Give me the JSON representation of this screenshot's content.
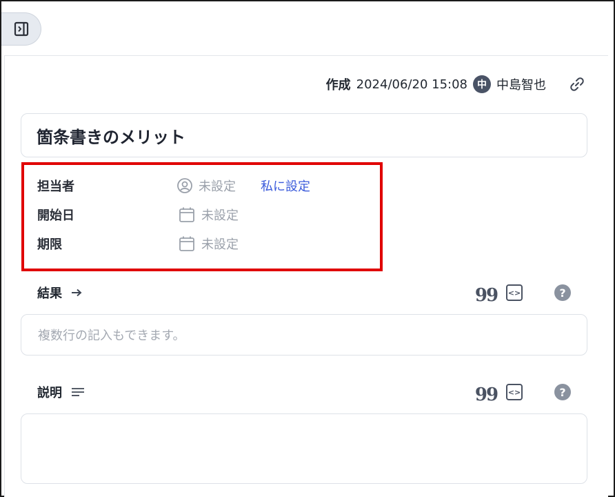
{
  "meta": {
    "created_label": "作成",
    "created_at": "2024/06/20 15:08",
    "avatar_initial": "中",
    "author": "中島智也"
  },
  "task": {
    "title": "箇条書きのメリット"
  },
  "fields": {
    "assignee_label": "担当者",
    "assignee_value": "未設定",
    "assign_me": "私に設定",
    "start_label": "開始日",
    "start_value": "未設定",
    "due_label": "期限",
    "due_value": "未設定"
  },
  "result": {
    "label": "結果",
    "placeholder": "複数行の記入もできます。"
  },
  "description": {
    "label": "説明",
    "value": ""
  },
  "icons": {
    "sidebar": "sidebar-toggle-icon",
    "link": "link-icon",
    "person": "person-circle-icon",
    "calendar": "calendar-icon",
    "arrow": "arrow-right-icon",
    "lines": "text-lines-icon",
    "quote": "quote-icon",
    "code": "code-icon",
    "help": "help-icon"
  },
  "colors": {
    "accent_link": "#3b5bdb",
    "highlight_border": "#e00000",
    "placeholder": "#9aa0aa"
  }
}
